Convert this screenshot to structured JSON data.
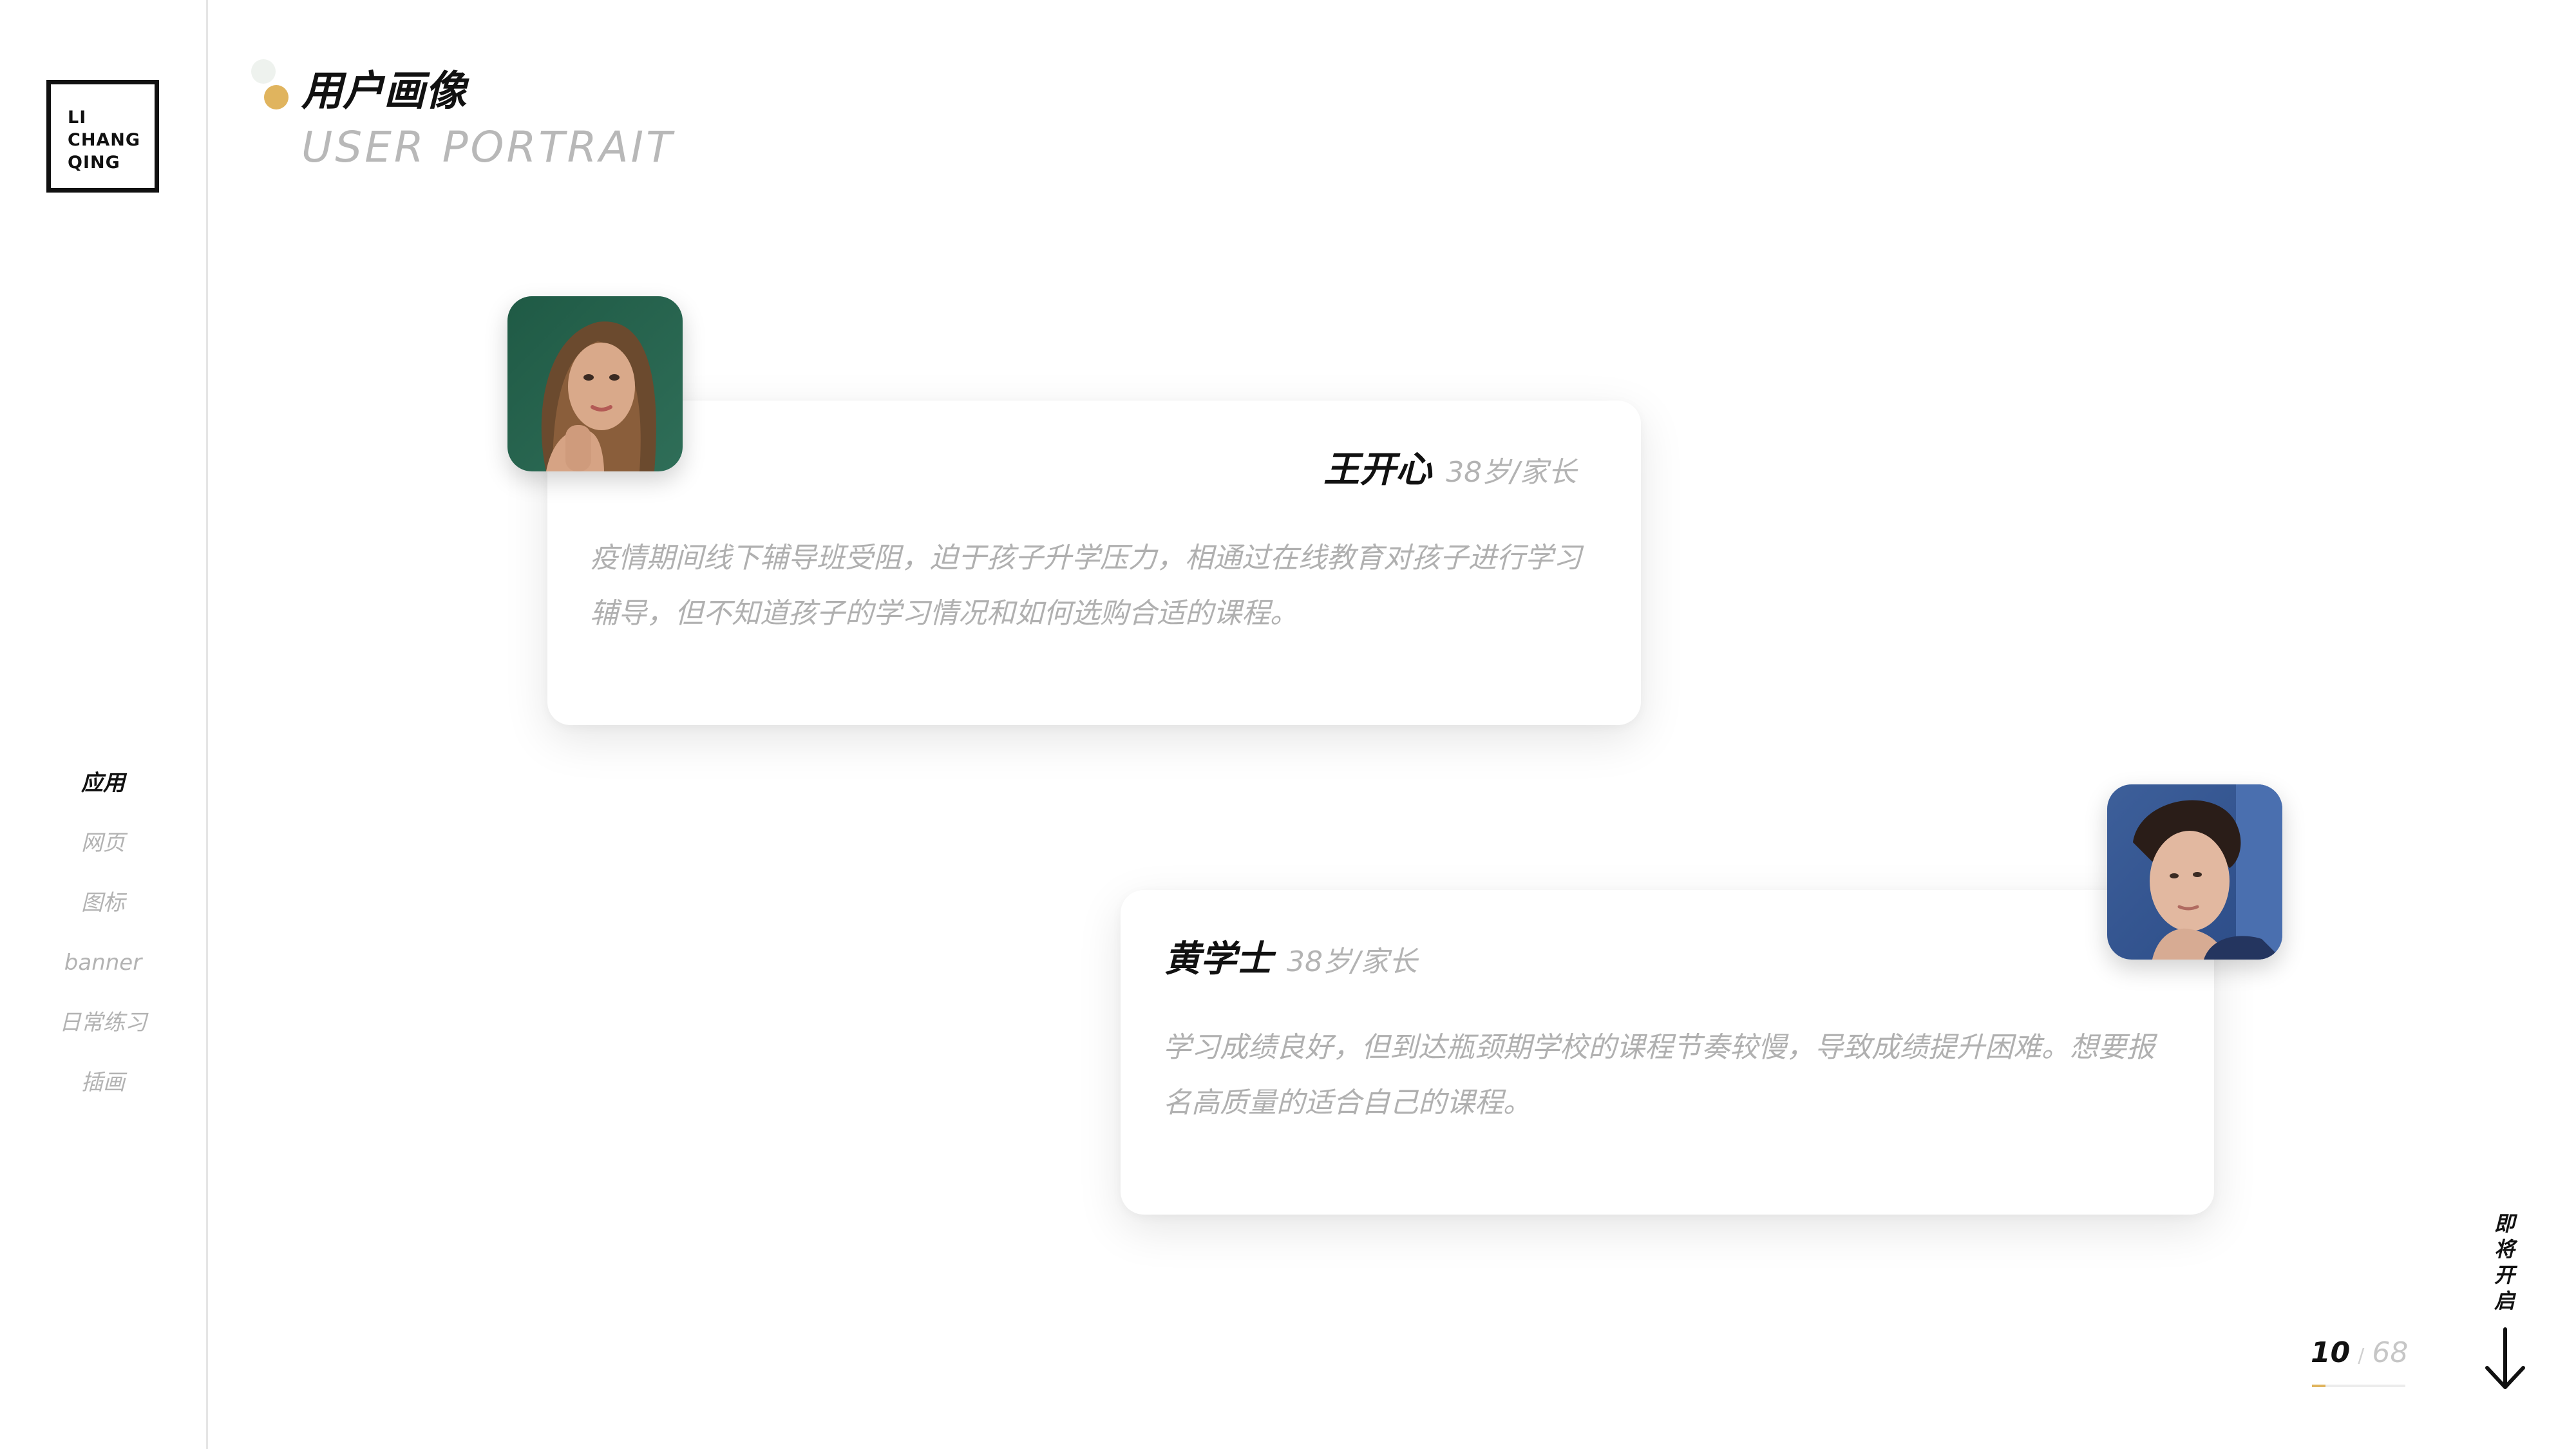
{
  "logo": {
    "lines": [
      "LI",
      "CHANG",
      "QING"
    ]
  },
  "header": {
    "title_cn": "用户画像",
    "title_en": "USER PORTRAIT"
  },
  "nav": {
    "items": [
      {
        "label": "应用",
        "active": true
      },
      {
        "label": "网页"
      },
      {
        "label": "图标"
      },
      {
        "label": "banner"
      },
      {
        "label": "日常练习"
      },
      {
        "label": "插画"
      }
    ]
  },
  "personas": [
    {
      "name": "王开心",
      "meta": "38岁/家长",
      "description": "疫情期间线下辅导班受阻，迫于孩子升学压力，相通过在线教育对孩子进行学习辅导，但不知道孩子的学习情况和如何选购合适的课程。",
      "avatar_icon": "woman-portrait-photo"
    },
    {
      "name": "黄学士",
      "meta": "38岁/家长",
      "description": "学习成绩良好，但到达瓶颈期学校的课程节奏较慢，导致成绩提升困难。想要报名高质量的适合自己的课程。",
      "avatar_icon": "man-portrait-photo"
    }
  ],
  "pager": {
    "current": "10",
    "separator": "/",
    "total": "68",
    "progress_fraction": 0.147
  },
  "footer": {
    "coming_soon": "即将开启",
    "arrow_icon": "arrow-down-icon"
  },
  "colors": {
    "accent": "#e0b45e",
    "muted": "#b3b3b3",
    "text": "#111111"
  }
}
